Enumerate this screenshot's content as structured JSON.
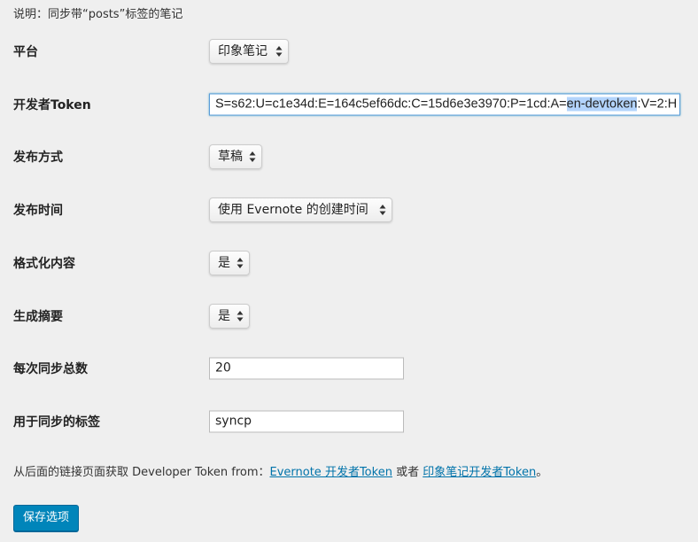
{
  "note": "说明：同步带“posts”标签的笔记",
  "fields": {
    "platform": {
      "label": "平台",
      "value": "印象笔记"
    },
    "token": {
      "label": "开发者Token",
      "value_before": "S=s62:U=c1e34d:E=164c5ef66dc:C=15d6e3e3970:P=1cd:A=",
      "value_selected": "en-devtoken",
      "value_after": ":V=2:H"
    },
    "publish_mode": {
      "label": "发布方式",
      "value": "草稿"
    },
    "publish_time": {
      "label": "发布时间",
      "value": "使用 Evernote 的创建时间"
    },
    "format_content": {
      "label": "格式化内容",
      "value": "是"
    },
    "gen_excerpt": {
      "label": "生成摘要",
      "value": "是"
    },
    "sync_total": {
      "label": "每次同步总数",
      "value": "20"
    },
    "sync_tag": {
      "label": "用于同步的标签",
      "value": "syncp"
    }
  },
  "footnote": {
    "prefix": "从后面的链接页面获取 Developer Token from：",
    "link1": "Evernote 开发者Token",
    "middle": " 或者 ",
    "link2": "印象笔记开发者Token",
    "suffix": "。"
  },
  "save_button": "保存选项",
  "colors": {
    "background": "#efefef",
    "link": "#0073aa",
    "primary_button": "#0085ba",
    "selection": "#b3d4fc",
    "focus_border": "#5b9dd9"
  },
  "icons": {
    "select_arrows": "updown-arrows-icon"
  }
}
